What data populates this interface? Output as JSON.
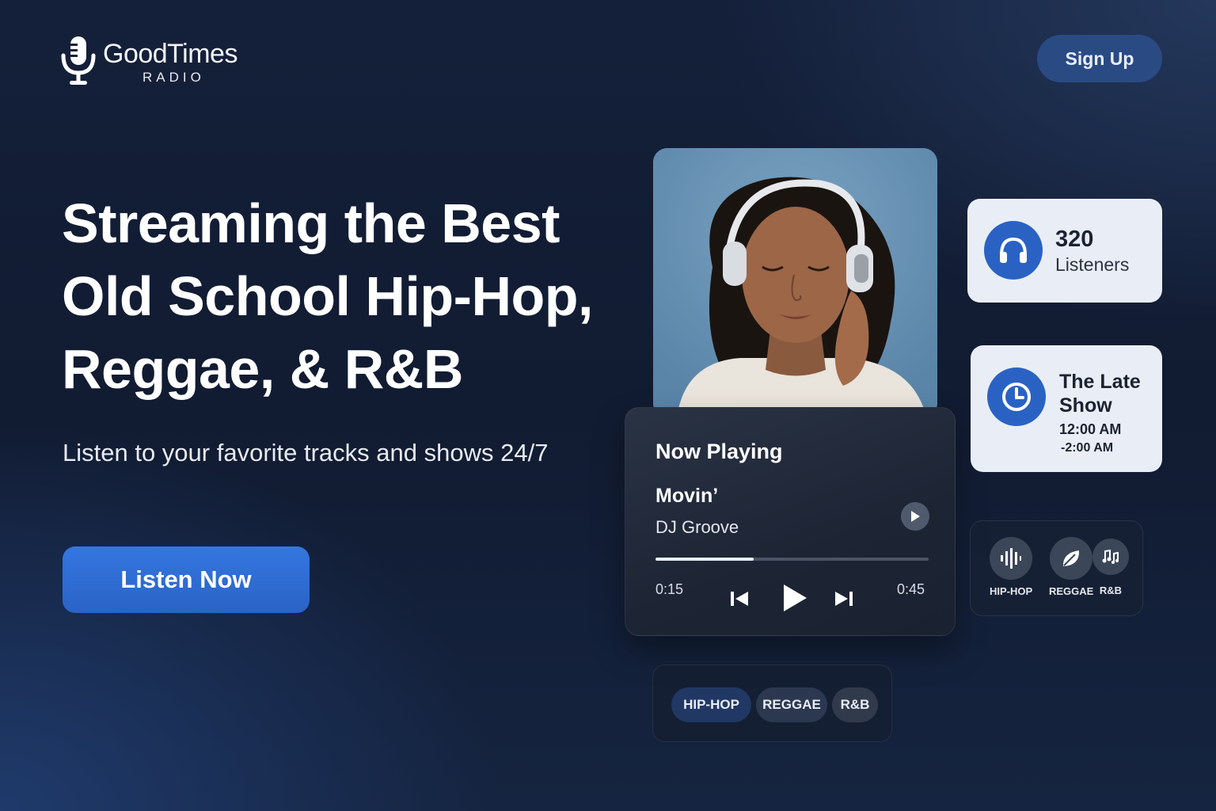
{
  "brand": {
    "name": "GoodTimes",
    "sub": "RADIO",
    "icon": "microphone-icon"
  },
  "header": {
    "signup_label": "Sign Up"
  },
  "hero": {
    "title": "Streaming the Best Old School Hip-Hop, Reggae, & R&B",
    "subtitle": "Listen to your favorite tracks and shows 24/7",
    "cta_label": "Listen Now"
  },
  "now_playing": {
    "heading": "Now Playing",
    "track": "Movin’",
    "artist": "DJ Groove",
    "elapsed": "0:15",
    "duration": "0:45",
    "progress": 0.36,
    "icons": [
      "play-circle-icon",
      "skip-back-icon",
      "play-icon",
      "skip-forward-icon"
    ]
  },
  "listeners": {
    "count": "320",
    "label": "Listeners",
    "icon": "headphones-icon"
  },
  "show": {
    "name": "The Late Show",
    "time_start": "12:00 AM",
    "time_end": "-2:00 AM",
    "icon": "clock-icon"
  },
  "genre_icons": [
    {
      "label": "HIP-HOP",
      "icon": "soundwave-icon"
    },
    {
      "label": "REGGAE",
      "icon": "leaf-icon"
    },
    {
      "label": "R&B",
      "icon": "music-notes-icon"
    }
  ],
  "genre_chips": [
    "HIP-HOP",
    "REGGAE",
    "R&B"
  ],
  "colors": {
    "accent": "#2f6fd8",
    "signup_bg": "#2a4a84",
    "card_light": "#e9eef6",
    "background": "#14203a"
  }
}
